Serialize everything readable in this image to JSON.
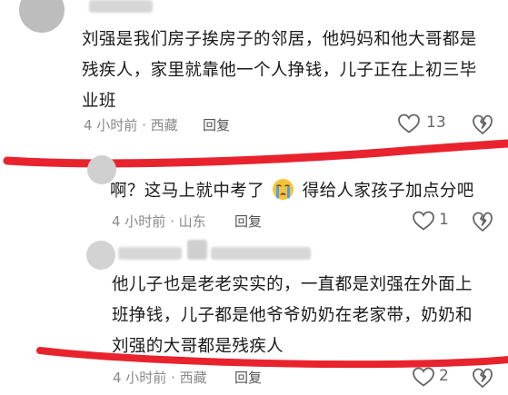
{
  "comments": [
    {
      "text_lines": [
        "刘强是我们房子挨房子的邻居，他妈妈和他大哥都是",
        "残疾人，家里就靠他一个人挣钱，儿子正在上初三毕",
        "业班"
      ],
      "time_location": "4 小时前 · 西藏",
      "reply_label": "回复",
      "like_count": "13"
    },
    {
      "text_before_emoji": "啊？这马上就中考了",
      "text_after_emoji": "得给人家孩子加点分吧",
      "emoji_icon": "crying-face",
      "time_location": "4 小时前 · 山东",
      "reply_label": "回复",
      "like_count": "1"
    },
    {
      "text_lines": [
        "他儿子也是老老实实的，一直都是刘强在外面上",
        "班挣钱，儿子都是他爷爷奶奶在老家带，奶奶和",
        "刘强的大哥都是残疾人"
      ],
      "time_location": "4 小时前 · 西藏",
      "reply_label": "回复",
      "like_count": "2"
    }
  ],
  "colors": {
    "annotation_red": "#e8232e",
    "text": "#1a1a1a",
    "meta": "#8a8a8a"
  },
  "icons": [
    "heart-icon",
    "dislike-icon",
    "crying-face-emoji"
  ]
}
